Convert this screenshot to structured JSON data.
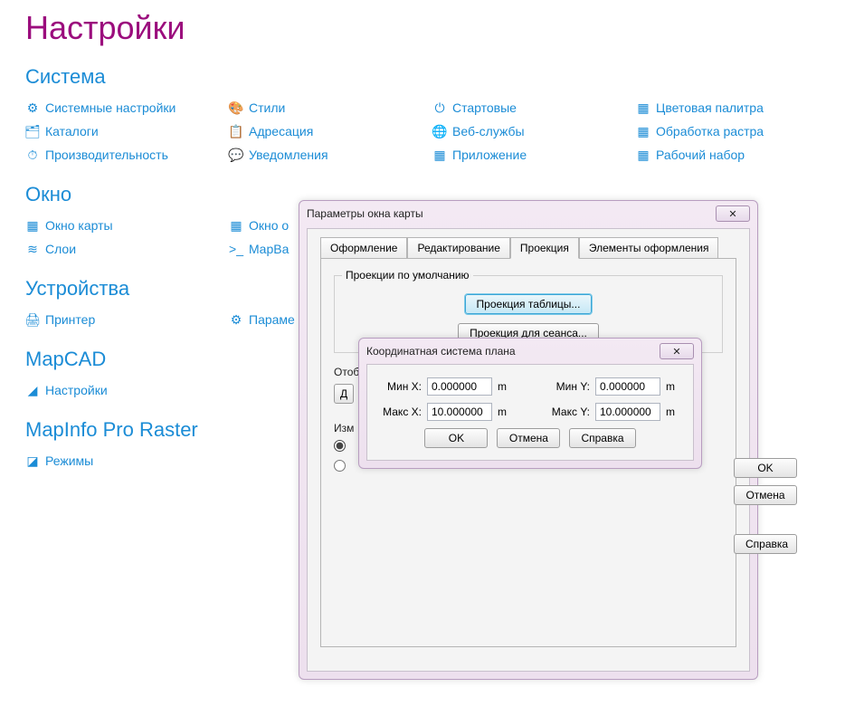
{
  "page_title": "Настройки",
  "sections": {
    "system": {
      "title": "Система",
      "cols": [
        [
          {
            "icon": "⚙",
            "label": "Системные настройки"
          },
          {
            "icon": "🗂",
            "label": "Каталоги"
          },
          {
            "icon": "⏱",
            "label": "Производительность"
          }
        ],
        [
          {
            "icon": "🎨",
            "label": "Стили"
          },
          {
            "icon": "📋",
            "label": "Адресация"
          },
          {
            "icon": "💬",
            "label": "Уведомления"
          }
        ],
        [
          {
            "icon": "⏻",
            "label": "Стартовые"
          },
          {
            "icon": "🌐",
            "label": "Веб-службы"
          },
          {
            "icon": "▦",
            "label": "Приложение"
          }
        ],
        [
          {
            "icon": "▦",
            "label": "Цветовая палитра"
          },
          {
            "icon": "▦",
            "label": "Обработка растра"
          },
          {
            "icon": "▦",
            "label": "Рабочий набор"
          }
        ]
      ]
    },
    "window": {
      "title": "Окно",
      "cols": [
        [
          {
            "icon": "▦",
            "label": "Окно карты"
          },
          {
            "icon": "≋",
            "label": "Слои"
          }
        ],
        [
          {
            "icon": "▦",
            "label": "Окно о"
          },
          {
            "icon": ">_",
            "label": "MapBa"
          }
        ]
      ]
    },
    "devices": {
      "title": "Устройства",
      "cols": [
        [
          {
            "icon": "🖨",
            "label": "Принтер"
          }
        ],
        [
          {
            "icon": "⚙",
            "label": "Параме"
          }
        ]
      ]
    },
    "mapcad": {
      "title": "MapCAD",
      "cols": [
        [
          {
            "icon": "◢",
            "label": "Настройки"
          }
        ]
      ]
    },
    "raster": {
      "title": "MapInfo Pro Raster",
      "cols": [
        [
          {
            "icon": "◪",
            "label": "Режимы"
          }
        ]
      ]
    }
  },
  "dialog_outer": {
    "title": "Параметры окна карты",
    "tabs": [
      "Оформление",
      "Редактирование",
      "Проекция",
      "Элементы оформления"
    ],
    "fieldset_legend": "Проекции по умолчанию",
    "btn_table_proj": "Проекция таблицы...",
    "btn_session_proj": "Проекция для сеанса...",
    "label_otob": "Отоб",
    "label_d": "Д",
    "label_izm": "Изм",
    "side_ok": "OK",
    "side_cancel": "Отмена",
    "side_help": "Справка"
  },
  "dialog_inner": {
    "title": "Координатная система плана",
    "minx_label": "Мин X:",
    "maxx_label": "Макс X:",
    "miny_label": "Мин Y:",
    "maxy_label": "Макс Y:",
    "minx": "0.000000",
    "maxx": "10.000000",
    "miny": "0.000000",
    "maxy": "10.000000",
    "unit": "m",
    "ok": "OK",
    "cancel": "Отмена",
    "help": "Справка"
  }
}
